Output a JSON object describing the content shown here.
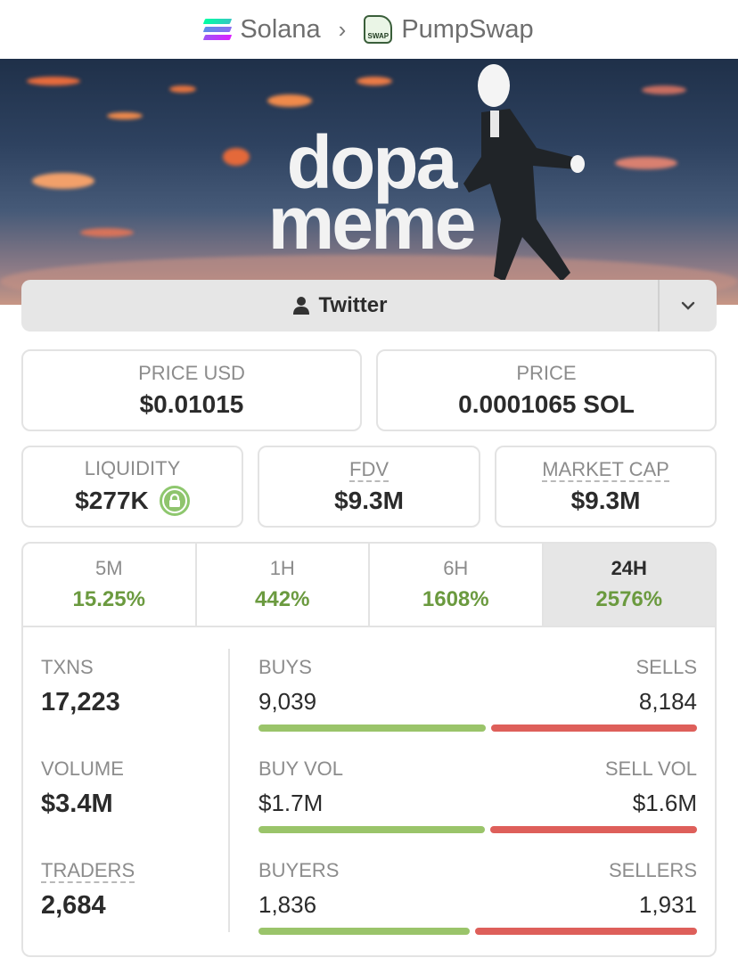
{
  "breadcrumb": {
    "chain": "Solana",
    "separator": ">",
    "dex": "PumpSwap",
    "dex_logo_text": "SWAP"
  },
  "banner": {
    "title_line1": "dopa",
    "title_line2": "meme"
  },
  "social": {
    "twitter_label": "Twitter"
  },
  "price": {
    "price_usd_label": "PRICE USD",
    "price_usd": "$0.01015",
    "price_label": "PRICE",
    "price_native": "0.0001065 SOL"
  },
  "metrics": {
    "liquidity_label": "LIQUIDITY",
    "liquidity": "$277K",
    "fdv_label": "FDV",
    "fdv": "$9.3M",
    "mcap_label": "MARKET CAP",
    "mcap": "$9.3M"
  },
  "periods": [
    {
      "label": "5M",
      "change": "15.25%"
    },
    {
      "label": "1H",
      "change": "442%"
    },
    {
      "label": "6H",
      "change": "1608%"
    },
    {
      "label": "24H",
      "change": "2576%"
    }
  ],
  "active_period": "24H",
  "stats": {
    "txns_label": "TXNS",
    "txns": "17,223",
    "volume_label": "VOLUME",
    "volume": "$3.4M",
    "traders_label": "TRADERS",
    "traders": "2,684"
  },
  "splits": {
    "txns": {
      "left_label": "BUYS",
      "left": "9,039",
      "right_label": "SELLS",
      "right": "8,184",
      "left_fraction": 0.525
    },
    "volume": {
      "left_label": "BUY VOL",
      "left": "$1.7M",
      "right_label": "SELL VOL",
      "right": "$1.6M",
      "left_fraction": 0.522
    },
    "traders": {
      "left_label": "BUYERS",
      "left": "1,836",
      "right_label": "SELLERS",
      "right": "1,931",
      "left_fraction": 0.487
    }
  },
  "colors": {
    "positive": "#6b9a3f",
    "buy_bar": "#9ac46a",
    "sell_bar": "#de5f5a",
    "lock": "#8fc46d"
  }
}
